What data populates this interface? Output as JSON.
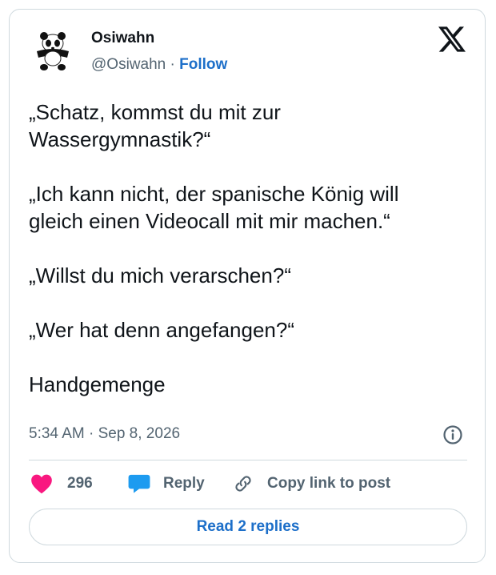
{
  "author": {
    "name": "Osiwahn",
    "handle": "@Osiwahn",
    "separator": "·",
    "follow_label": "Follow"
  },
  "tweet": {
    "paragraphs": [
      [
        "„Schatz, kommst du mit zur",
        "Wassergymnastik?“"
      ],
      [
        "„Ich kann nicht, der spanische König will",
        "gleich einen Videocall mit mir machen.“"
      ],
      [
        "„Willst du mich verarschen?“"
      ],
      [
        "„Wer hat denn angefangen?“"
      ],
      [
        "Handgemenge"
      ]
    ],
    "timestamp": "5:34 AM · Sep 8, 2026"
  },
  "actions": {
    "likes_count": "296",
    "reply_label": "Reply",
    "copy_link_label": "Copy link to post"
  },
  "footer": {
    "read_replies_label": "Read 2 replies"
  },
  "icons": {
    "logo": "x-logo-icon",
    "info": "info-icon",
    "like": "heart-icon",
    "reply": "speech-bubble-icon",
    "copy": "link-icon"
  },
  "colors": {
    "link_blue": "#1d6fc9",
    "heart": "#f91880",
    "reply_bubble": "#1d9bf0",
    "secondary_text": "#536471",
    "border": "#cfd9de"
  }
}
